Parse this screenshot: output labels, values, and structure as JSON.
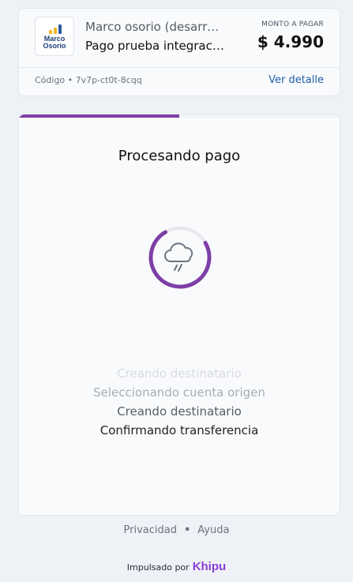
{
  "merchant": {
    "logo_line1": "Marco",
    "logo_line2": "Osorio",
    "name": "Marco osorio (desarr…",
    "subject": "Pago prueba integrac…",
    "amount_label": "MONTO A PAGAR",
    "amount": "$ 4.990",
    "code": "Código • 7v7p-ct0t-8cqq",
    "details_link": "Ver detalle"
  },
  "process": {
    "progress": 0.5,
    "title": "Procesando pago",
    "spinner_icon": "cloud-rain-icon",
    "steps": [
      "Creando destinatario",
      "Seleccionando cuenta origen",
      "Creando destinatario",
      "Confirmando transferencia"
    ]
  },
  "footer": {
    "privacy": "Privacidad",
    "separator": "•",
    "help": "Ayuda",
    "powered_by": "Impulsado por",
    "brand": "Khipu"
  },
  "colors": {
    "accent": "#7e3fa6",
    "link": "#1f5fa8",
    "brand": "#8b3fd6"
  }
}
